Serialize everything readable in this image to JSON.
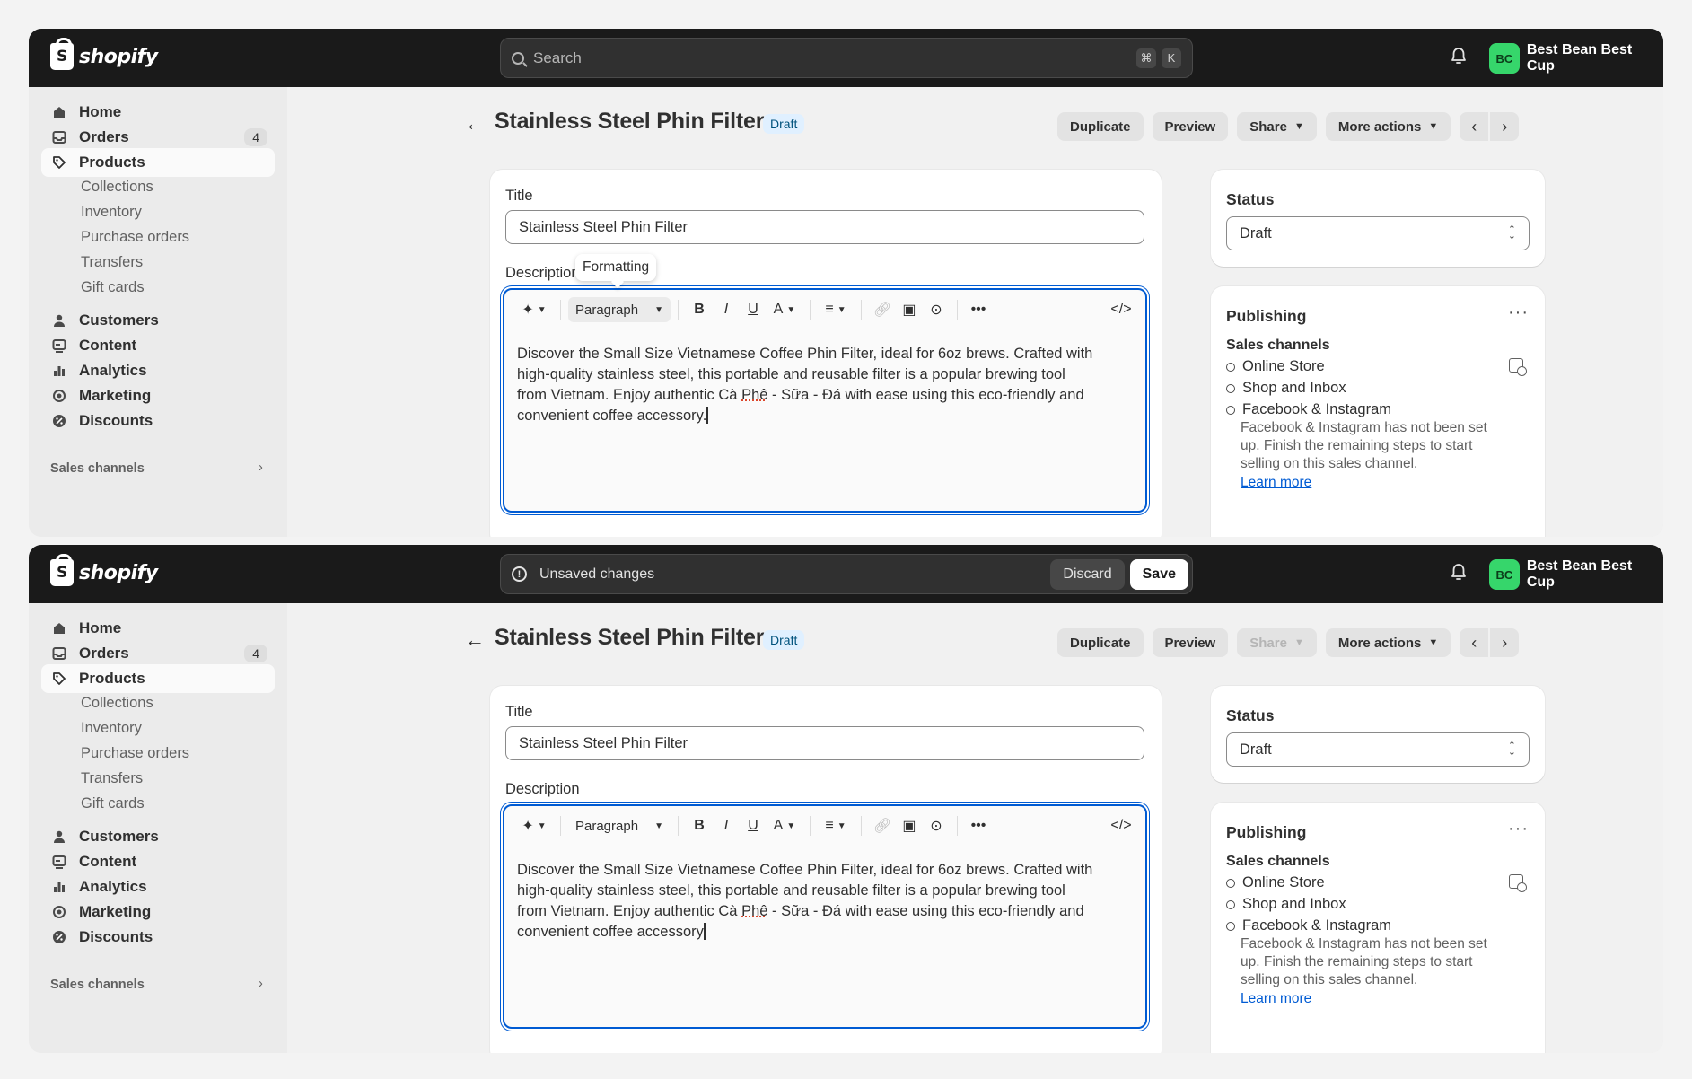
{
  "app": {
    "logo_text": "shopify",
    "store_name": "Best Bean Best Cup",
    "store_initials": "BC",
    "accent": "#005bd3",
    "avatar_color": "#36d66b"
  },
  "search": {
    "placeholder": "Search",
    "shortcut_keys": [
      "⌘",
      "K"
    ]
  },
  "unsaved_bar": {
    "message": "Unsaved changes",
    "discard_label": "Discard",
    "save_label": "Save"
  },
  "sidebar": {
    "home": "Home",
    "orders": "Orders",
    "orders_count": "4",
    "products": "Products",
    "sub_items": [
      "Collections",
      "Inventory",
      "Purchase orders",
      "Transfers",
      "Gift cards"
    ],
    "customers": "Customers",
    "content": "Content",
    "analytics": "Analytics",
    "marketing": "Marketing",
    "discounts": "Discounts",
    "sales_channels": "Sales channels"
  },
  "page": {
    "title": "Stainless Steel Phin Filter",
    "status_badge": "Draft",
    "actions": {
      "duplicate": "Duplicate",
      "preview": "Preview",
      "share": "Share",
      "more": "More actions"
    }
  },
  "product": {
    "title_label": "Title",
    "title_value": "Stainless Steel Phin Filter",
    "description_label": "Description",
    "tooltip": "Formatting",
    "paragraph_label": "Paragraph",
    "description_lines": [
      "Discover the Small Size Vietnamese Coffee Phin Filter, ideal for 6oz brews. Crafted with",
      "high-quality stainless steel, this portable and reusable filter is a popular brewing tool",
      "from Vietnam. Enjoy authentic Cà ",
      "Phê",
      " - Sữa - Đá with ease using this eco-friendly and",
      "convenient coffee accessory"
    ],
    "description_end_1": ".",
    "description_end_2": ""
  },
  "status_card": {
    "title": "Status",
    "value": "Draft"
  },
  "publishing": {
    "title": "Publishing",
    "sales_channels_label": "Sales channels",
    "channels": [
      "Online Store",
      "Shop and Inbox",
      "Facebook & Instagram"
    ],
    "fb_note": "Facebook & Instagram has not been set up. Finish the remaining steps to start selling on this sales channel.",
    "learn_more": "Learn more"
  }
}
